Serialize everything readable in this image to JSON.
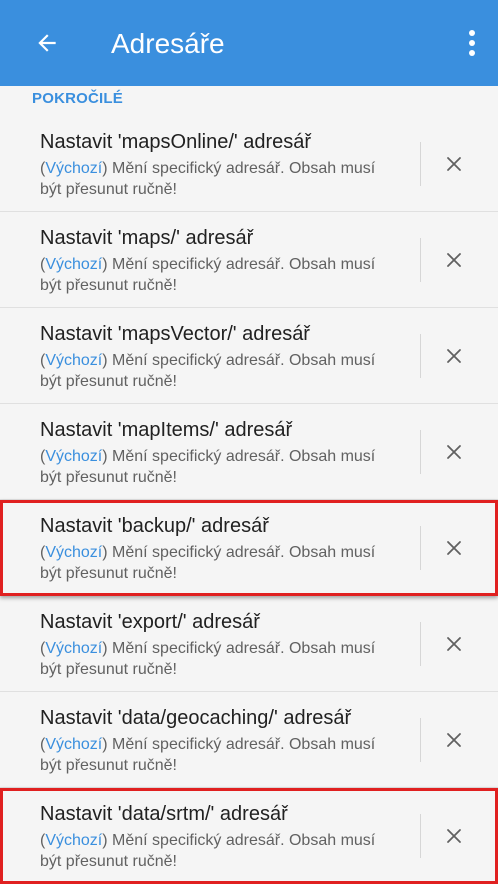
{
  "appbar": {
    "title": "Adresáře",
    "back_icon": "arrow-left-icon",
    "overflow_icon": "more-vert-icon",
    "color": "#3a8fde"
  },
  "section": {
    "title": "POKROČILÉ"
  },
  "colors": {
    "accent": "#3a8fde",
    "highlight": "#e02020"
  },
  "items": [
    {
      "title": "Nastavit 'mapsOnline/' adresář",
      "default_label": "Výchozí",
      "summary_text": " Mění specifický adresář. Obsah musí být přesunut ručně!",
      "highlighted": false
    },
    {
      "title": "Nastavit 'maps/' adresář",
      "default_label": "Výchozí",
      "summary_text": " Mění specifický adresář. Obsah musí být přesunut ručně!",
      "highlighted": false
    },
    {
      "title": "Nastavit 'mapsVector/' adresář",
      "default_label": "Výchozí",
      "summary_text": " Mění specifický adresář. Obsah musí být přesunut ručně!",
      "highlighted": false
    },
    {
      "title": "Nastavit 'mapItems/' adresář",
      "default_label": "Výchozí",
      "summary_text": " Mění specifický adresář. Obsah musí být přesunut ručně!",
      "highlighted": false
    },
    {
      "title": "Nastavit 'backup/' adresář",
      "default_label": "Výchozí",
      "summary_text": " Mění specifický adresář. Obsah musí být přesunut ručně!",
      "highlighted": true
    },
    {
      "title": "Nastavit 'export/' adresář",
      "default_label": "Výchozí",
      "summary_text": " Mění specifický adresář. Obsah musí být přesunut ručně!",
      "highlighted": false
    },
    {
      "title": "Nastavit 'data/geocaching/' adresář",
      "default_label": "Výchozí",
      "summary_text": " Mění specifický adresář. Obsah musí být přesunut ručně!",
      "highlighted": false
    },
    {
      "title": "Nastavit 'data/srtm/' adresář",
      "default_label": "Výchozí",
      "summary_text": " Mění specifický adresář. Obsah musí být přesunut ručně!",
      "highlighted": true
    }
  ]
}
